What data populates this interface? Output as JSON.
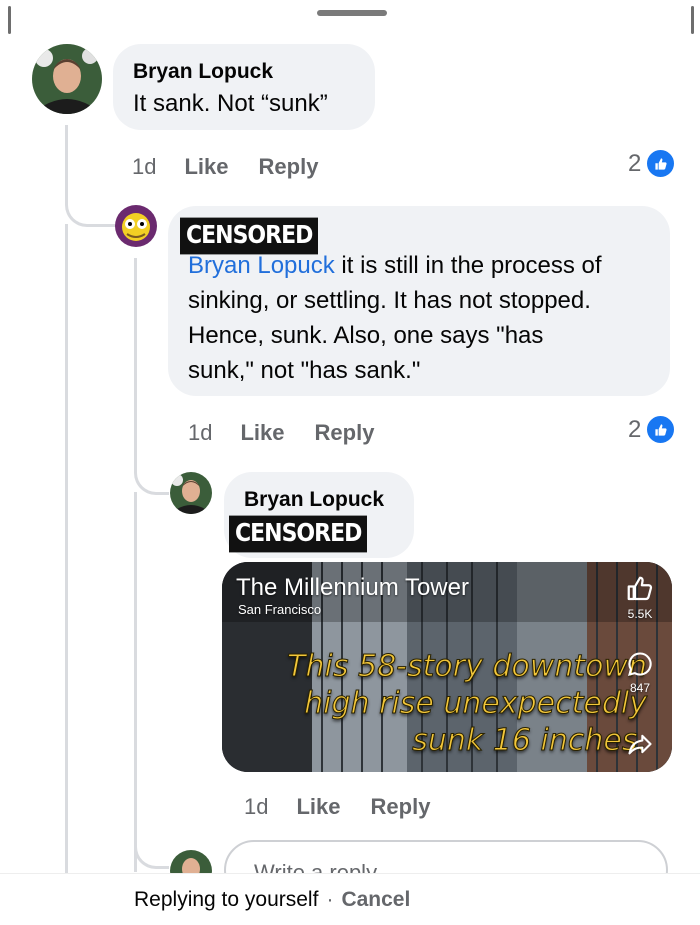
{
  "comment1": {
    "author": "Bryan Lopuck",
    "text": "It sank. Not “sunk”",
    "time": "1d",
    "like_label": "Like",
    "reply_label": "Reply",
    "reaction_count": "2"
  },
  "comment2": {
    "author_redacted": "CENSORED",
    "mention": "Bryan Lopuck",
    "text_lines": [
      " it is still in the process of",
      "sinking, or settling. It has not stopped.",
      "Hence, sunk. Also, one says \"has",
      "sunk,\" not \"has sank.\""
    ],
    "time": "1d",
    "like_label": "Like",
    "reply_label": "Reply",
    "reaction_count": "2"
  },
  "comment3": {
    "author": "Bryan Lopuck",
    "text_redacted": "CENSORED",
    "time": "1d",
    "like_label": "Like",
    "reply_label": "Reply",
    "video": {
      "title": "The Millennium Tower",
      "subtitle": "San Francisco",
      "caption_lines": [
        "This 58-story downtown",
        "high rise unexpectedly",
        "sunk 16 inches."
      ],
      "likes": "5.5K",
      "comments": "847"
    }
  },
  "reply_box": {
    "placeholder": "Write a reply..."
  },
  "bottom_bar": {
    "replying": "Replying to yourself",
    "separator": "·",
    "cancel": "Cancel"
  },
  "colors": {
    "accent": "#1877f2",
    "mention": "#216fdb",
    "caption": "#f3c73a",
    "bubble": "#f0f2f5"
  }
}
